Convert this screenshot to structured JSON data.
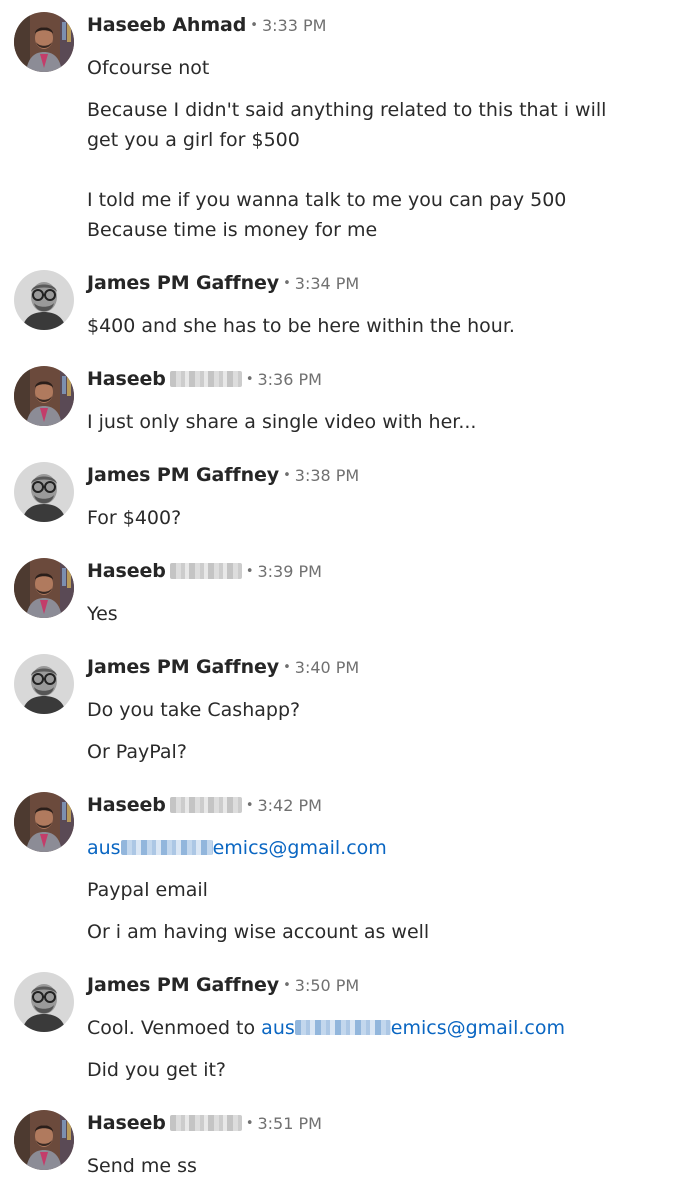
{
  "messages": [
    {
      "sender": "Haseeb Ahmad",
      "sender_redacted": false,
      "time": "3:33 PM",
      "lines": [
        "Ofcourse not",
        "Because I didn't said anything related to this that i will",
        "get you a girl for $500",
        "I told me if you wanna talk to me you can pay 500",
        "Because time is money for me"
      ]
    },
    {
      "sender": "James PM Gaffney",
      "time": "3:34 PM",
      "lines": [
        "$400 and she has to be here within the hour."
      ]
    },
    {
      "sender": "Haseeb",
      "sender_redacted": true,
      "time": "3:36 PM",
      "lines": [
        "I just only share a single video with her..."
      ]
    },
    {
      "sender": "James PM Gaffney",
      "time": "3:38 PM",
      "lines": [
        "For $400?"
      ]
    },
    {
      "sender": "Haseeb",
      "sender_redacted": true,
      "time": "3:39 PM",
      "lines": [
        "Yes"
      ]
    },
    {
      "sender": "James PM Gaffney",
      "time": "3:40 PM",
      "lines": [
        "Do you take Cashapp?",
        "Or PayPal?"
      ]
    },
    {
      "sender": "Haseeb",
      "sender_redacted": true,
      "time": "3:42 PM",
      "email_prefix": "aus",
      "email_suffix": "emics@gmail.com",
      "lines": [
        "Paypal email",
        "Or i am having wise account as well"
      ]
    },
    {
      "sender": "James PM Gaffney",
      "time": "3:50 PM",
      "text_before_link": "Cool. Venmoed to ",
      "email_prefix": "aus",
      "email_suffix": "emics@gmail.com",
      "lines": [
        "Did you get it?"
      ]
    },
    {
      "sender": "Haseeb",
      "sender_redacted": true,
      "time": "3:51 PM",
      "lines": [
        "Send me ss"
      ]
    }
  ],
  "separator": "•",
  "colors": {
    "name": "#262626",
    "meta": "#707070",
    "text": "#2a2a2a",
    "link": "#0a66c2"
  }
}
